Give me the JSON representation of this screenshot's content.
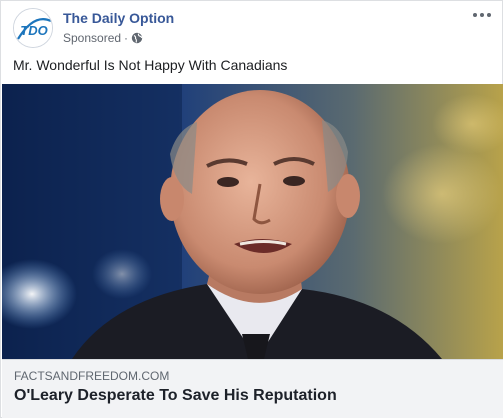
{
  "header": {
    "page_name": "The Daily Option",
    "sponsored_label": "Sponsored",
    "separator": "·",
    "avatar_text": "TDO",
    "privacy_icon": "globe-icon",
    "more_icon": "more-dots-icon"
  },
  "post": {
    "caption": "Mr. Wonderful Is Not Happy With Canadians"
  },
  "link_preview": {
    "domain": "FACTSANDFREEDOM.COM",
    "title": "O'Leary Desperate To Save His Reputation"
  },
  "colors": {
    "page_name": "#385898",
    "meta_text": "#616770",
    "link_bg": "#f2f3f5",
    "avatar_blue": "#1c75bc"
  }
}
